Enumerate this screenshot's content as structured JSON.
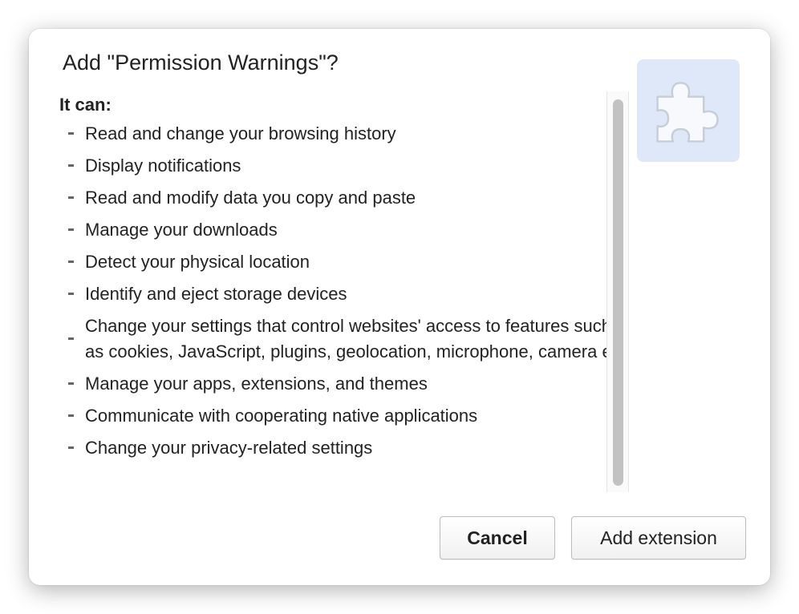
{
  "dialog": {
    "title": "Add \"Permission Warnings\"?",
    "subtitle": "It can:",
    "permissions": [
      "Read and change your browsing history",
      "Display notifications",
      "Read and modify data you copy and paste",
      "Manage your downloads",
      "Detect your physical location",
      "Identify and eject storage devices",
      "Change your settings that control websites' access to features such as cookies, JavaScript, plugins, geolocation, microphone, camera etc.",
      "Manage your apps, extensions, and themes",
      "Communicate with cooperating native applications",
      "Change your privacy-related settings"
    ],
    "icon": "puzzle-piece-icon",
    "buttons": {
      "cancel": "Cancel",
      "add": "Add extension"
    }
  },
  "colors": {
    "icon_background": "#dfe8f8",
    "text": "#222222"
  }
}
